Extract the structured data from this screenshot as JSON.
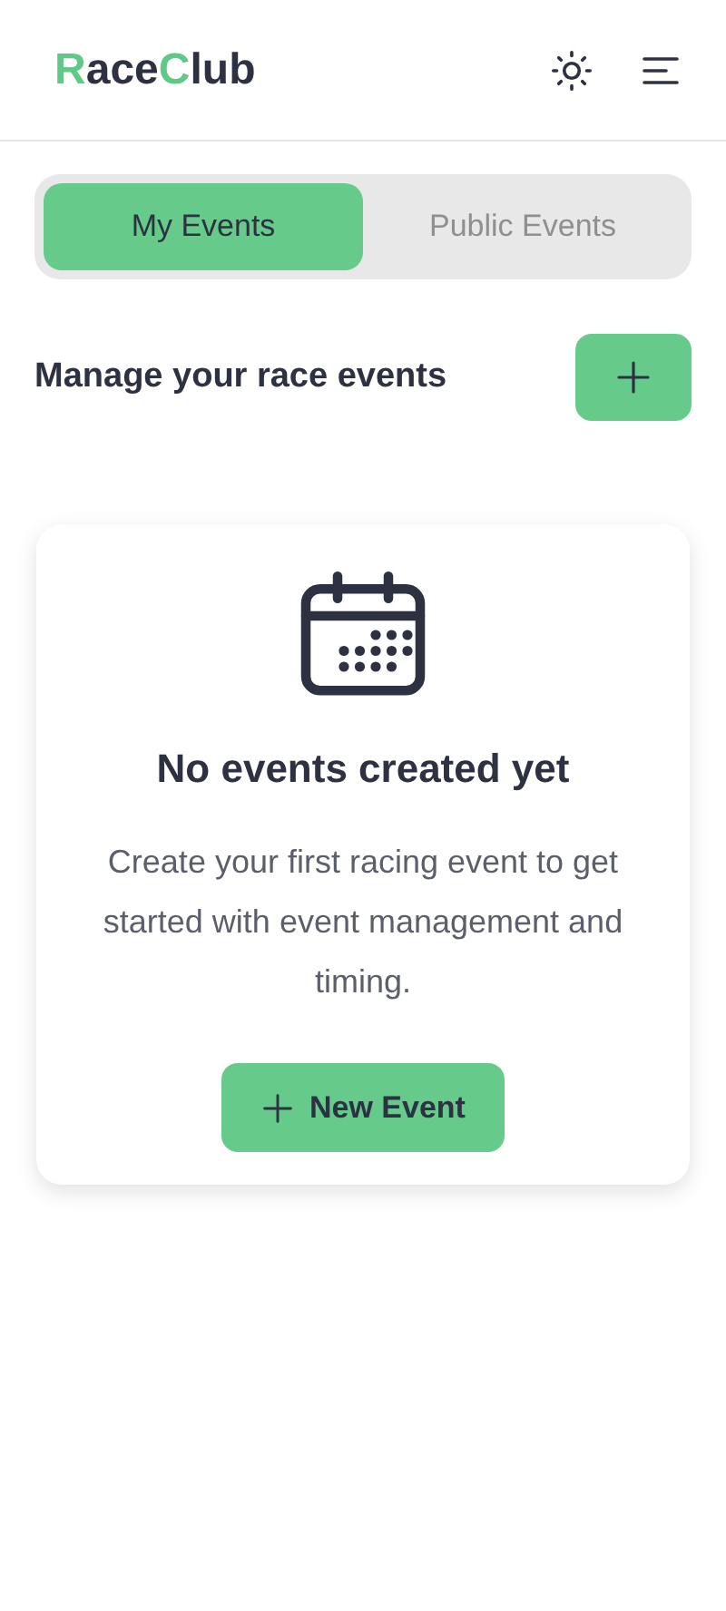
{
  "header": {
    "logo": [
      {
        "text": "R",
        "accent": true
      },
      {
        "text": "ace",
        "accent": false
      },
      {
        "text": "C",
        "accent": true
      },
      {
        "text": "lub",
        "accent": false
      }
    ]
  },
  "tabs": [
    {
      "label": "My Events",
      "selected": true
    },
    {
      "label": "Public Events",
      "selected": false
    }
  ],
  "section": {
    "title": "Manage your race events"
  },
  "empty_state": {
    "title": "No events created yet",
    "description": "Create your first racing event to get started with event management and timing.",
    "button": "New Event"
  }
}
